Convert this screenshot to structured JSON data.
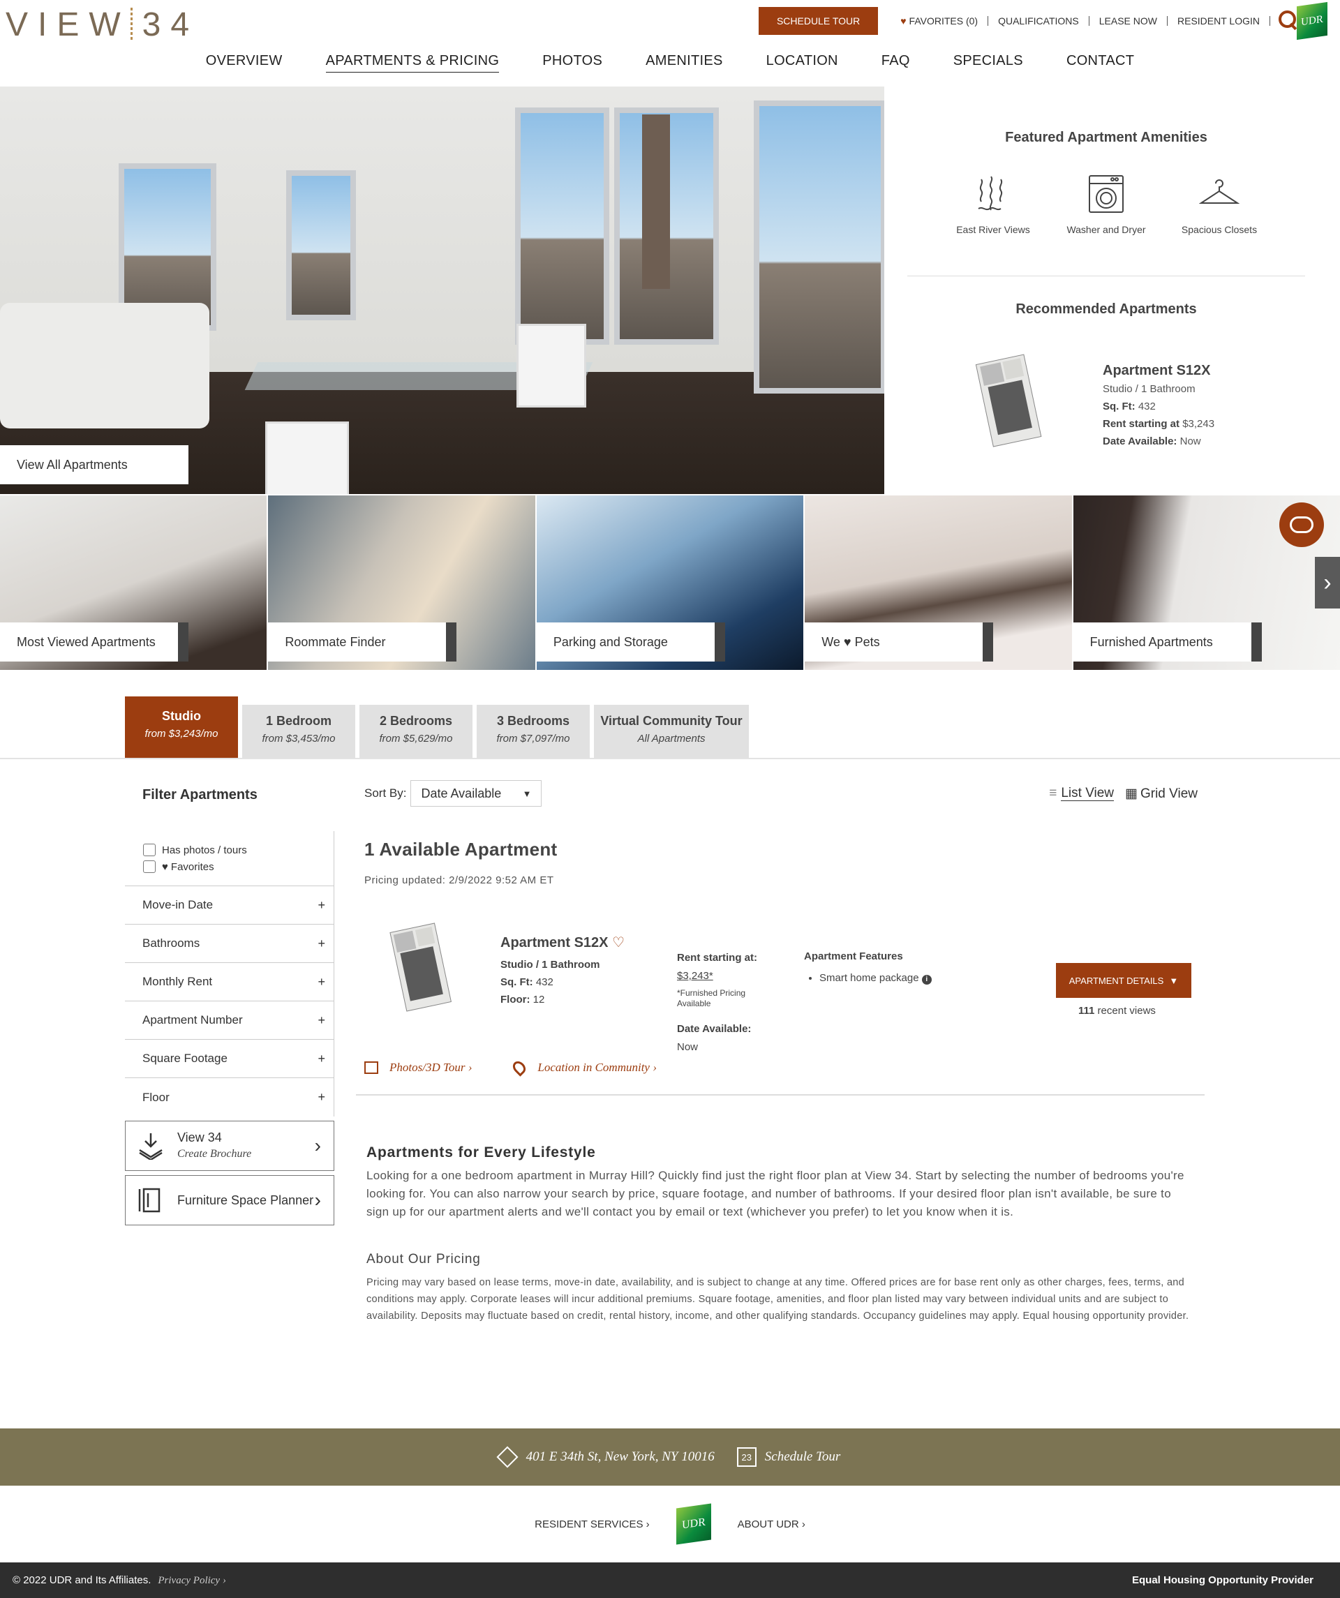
{
  "brand": {
    "logo_left": "VIEW",
    "logo_right": "34",
    "udr": "UDR"
  },
  "util": {
    "schedule_tour": "SCHEDULE TOUR",
    "favorites": "FAVORITES (0)",
    "qualifications": "QUALIFICATIONS",
    "lease_now": "LEASE NOW",
    "resident_login": "RESIDENT LOGIN"
  },
  "nav": [
    "OVERVIEW",
    "APARTMENTS & PRICING",
    "PHOTOS",
    "AMENITIES",
    "LOCATION",
    "FAQ",
    "SPECIALS",
    "CONTACT"
  ],
  "hero": {
    "view_all": "View All Apartments"
  },
  "featured": {
    "title": "Featured Apartment Amenities",
    "items": [
      {
        "label": "East River Views",
        "icon": "river-view-icon"
      },
      {
        "label": "Washer and Dryer",
        "icon": "washer-icon"
      },
      {
        "label": "Spacious Closets",
        "icon": "hanger-icon"
      }
    ]
  },
  "recommended": {
    "title": "Recommended Apartments",
    "name": "Apartment S12X",
    "type": "Studio / 1 Bathroom",
    "sqft_label": "Sq. Ft:",
    "sqft": "432",
    "rent_label": "Rent starting at",
    "rent": "$3,243",
    "date_label": "Date Available:",
    "date": "Now"
  },
  "tiles": [
    "Most Viewed Apartments",
    "Roommate Finder",
    "Parking and Storage",
    "We ♥ Pets",
    "Furnished Apartments"
  ],
  "tabs": [
    {
      "a": "Studio",
      "b": "from $3,243/mo"
    },
    {
      "a": "1 Bedroom",
      "b": "from $3,453/mo"
    },
    {
      "a": "2 Bedrooms",
      "b": "from $5,629/mo"
    },
    {
      "a": "3 Bedrooms",
      "b": "from $7,097/mo"
    },
    {
      "a": "Virtual Community Tour",
      "b": "All Apartments"
    }
  ],
  "filter": {
    "title": "Filter Apartments",
    "photos": "Has photos / tours",
    "favorites": "Favorites",
    "rows": [
      "Move-in Date",
      "Bathrooms",
      "Monthly Rent",
      "Apartment Number",
      "Square Footage",
      "Floor"
    ],
    "brochure_title": "View 34",
    "brochure_sub": "Create Brochure",
    "planner": "Furniture Space Planner"
  },
  "main": {
    "sort_label": "Sort By:",
    "sort_value": "Date Available",
    "list_view": "List View",
    "grid_view": "Grid View",
    "count": "1 Available Apartment",
    "updated": "Pricing updated: 2/9/2022 9:52 AM ET"
  },
  "unit": {
    "name": "Apartment S12X",
    "type": "Studio / 1 Bathroom",
    "sqft_label": "Sq. Ft:",
    "sqft": "432",
    "floor_label": "Floor:",
    "floor": "12",
    "rent_label": "Rent starting at:",
    "rent": "$3,243*",
    "furnished": "*Furnished Pricing Available",
    "date_label": "Date Available:",
    "date": "Now",
    "features_label": "Apartment Features",
    "feature1": "Smart home package",
    "details_btn": "APARTMENT DETAILS",
    "views": "111",
    "views_suffix": "recent views",
    "photos_link": "Photos/3D Tour ›",
    "location_link": "Location in Community ›"
  },
  "about": {
    "h1": "Apartments for Every Lifestyle",
    "p1": "Looking for a one bedroom apartment in Murray Hill? Quickly find just the right floor plan at View 34. Start by selecting the number of bedrooms you're looking for. You can also narrow your search by price, square footage, and number of bathrooms. If your desired floor plan isn't available, be sure to sign up for our apartment alerts and we'll contact you by email or text (whichever you prefer) to let you know when it is.",
    "h2": "About Our Pricing",
    "p2": "Pricing may vary based on lease terms, move-in date, availability, and is subject to change at any time. Offered prices are for base rent only as other charges, fees, terms, and conditions may apply. Corporate leases will incur additional premiums. Square footage, amenities, and floor plan listed may vary between individual units and are subject to availability. Deposits may fluctuate based on credit, rental history, income, and other qualifying standards. Occupancy guidelines may apply. Equal housing opportunity provider."
  },
  "footer": {
    "address": "401 E 34th St, New York, NY 10016",
    "schedule": "Schedule Tour",
    "cal_day": "23",
    "resident": "RESIDENT SERVICES ›",
    "about_udr": "ABOUT UDR ›",
    "copyright": "© 2022 UDR and Its Affiliates.",
    "privacy": "Privacy Policy ›",
    "eho": "Equal Housing Opportunity Provider"
  },
  "colors": {
    "accent": "#9c3d10",
    "footer_band": "#7c7453",
    "dark": "#2e2e2e"
  }
}
